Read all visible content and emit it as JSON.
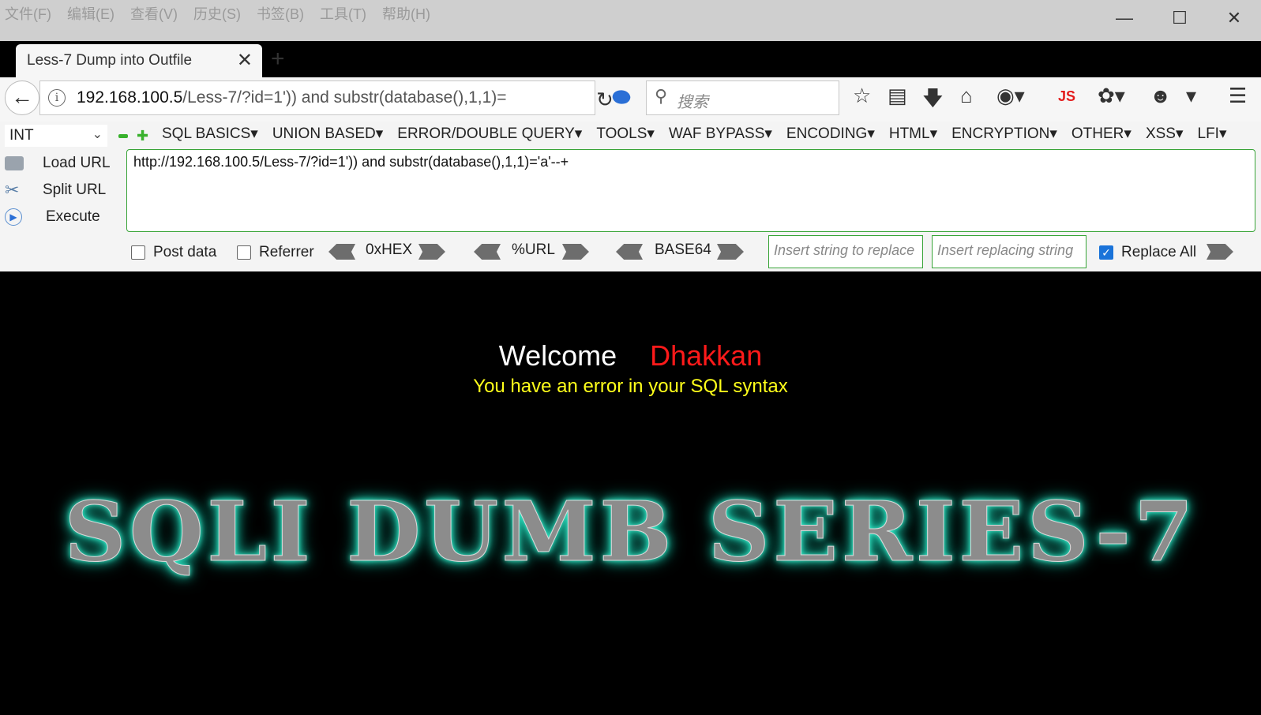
{
  "menu": [
    "文件(F)",
    "编辑(E)",
    "查看(V)",
    "历史(S)",
    "书签(B)",
    "工具(T)",
    "帮助(H)"
  ],
  "window": {
    "minimize": "—",
    "maximize": "☐",
    "close": "✕"
  },
  "tab": {
    "title": "Less-7 Dump into Outfile",
    "close": "✕",
    "new": "+"
  },
  "nav": {
    "url_host": "192.168.100.5",
    "url_path": "/Less-7/?id=1')) and substr(database(),1,1)=",
    "search_placeholder": "搜索",
    "js_label": "JS"
  },
  "hackbar": {
    "type_select": "INT",
    "menus": [
      "SQL BASICS▾",
      "UNION BASED▾",
      "ERROR/DOUBLE QUERY▾",
      "TOOLS▾",
      "WAF BYPASS▾",
      "ENCODING▾",
      "HTML▾",
      "ENCRYPTION▾",
      "OTHER▾",
      "XSS▾",
      "LFI▾"
    ],
    "load_url": "Load URL",
    "split_url": "Split URL",
    "execute": "Execute",
    "url_value": "http://192.168.100.5/Less-7/?id=1')) and substr(database(),1,1)='a'--+",
    "post_data": "Post data",
    "referrer": "Referrer",
    "hex": "0xHEX",
    "urlenc": "%URL",
    "base64": "BASE64",
    "replace_placeholder": "Insert string to replace",
    "replacing_placeholder": "Insert replacing string",
    "replace_all": "Replace All",
    "replace_all_checked": true
  },
  "page": {
    "welcome": "Welcome",
    "name": "Dhakkan",
    "error": "You have an error in your SQL syntax",
    "banner": "SQLI DUMB SERIES-7"
  }
}
